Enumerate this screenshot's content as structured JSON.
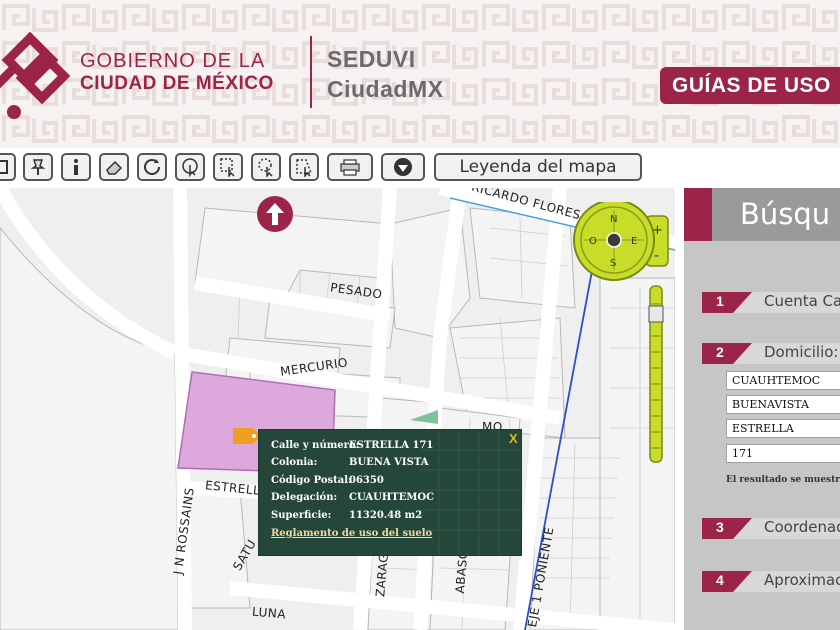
{
  "header": {
    "gov_line1": "GOBIERNO DE LA",
    "gov_line2": "CIUDAD DE MÉXICO",
    "agency_line1": "SEDUVI",
    "agency_line2": "CiudadMX",
    "guides_banner": "GUÍAS DE USO"
  },
  "toolbar": {
    "legend_button": "Leyenda del mapa"
  },
  "map": {
    "streets": {
      "ricardo_flores": "RICARDO FLORES",
      "pesado": "PESADO",
      "mercurio": "MERCURIO",
      "estrella": "ESTRELL",
      "rossains": "J N ROSSAINS",
      "saturno": "SATU",
      "zaragoza": "ZARAG",
      "abasolo": "ABASOLO",
      "eje1": "EJE 1 PONIENTE",
      "luna": "LUNA",
      "mo": "MO"
    },
    "compass": {
      "n": "N",
      "s": "S",
      "e": "E",
      "o": "O"
    },
    "zoom": {
      "plus": "+",
      "minus": "-"
    }
  },
  "popup": {
    "close": "X",
    "rows": [
      {
        "label": "Calle y número:",
        "value": "ESTRELLA 171"
      },
      {
        "label": "Colonia:",
        "value": "BUENA VISTA"
      },
      {
        "label": "Código Postal:",
        "value": "06350"
      },
      {
        "label": "Delegación:",
        "value": "CUAUHTEMOC"
      },
      {
        "label": "Superficie:",
        "value": "11320.48 m2"
      }
    ],
    "link": "Reglamento de uso del suelo"
  },
  "panel": {
    "title": "Búsqu",
    "steps": [
      {
        "num": "1",
        "label": "Cuenta Ca"
      },
      {
        "num": "2",
        "label": "Domicilio:"
      },
      {
        "num": "3",
        "label": "Coordenad"
      },
      {
        "num": "4",
        "label": "Aproximac"
      }
    ],
    "fields": {
      "delegacion": "CUAUHTEMOC",
      "colonia": "BUENAVISTA",
      "calle": "ESTRELLA",
      "numero": "171"
    },
    "result_note": "El resultado se muestra"
  },
  "colors": {
    "brand": "#9d2449",
    "popup_bg": "#24473a",
    "parcel": "#dda8dc",
    "compass": "#c8dc2a"
  }
}
